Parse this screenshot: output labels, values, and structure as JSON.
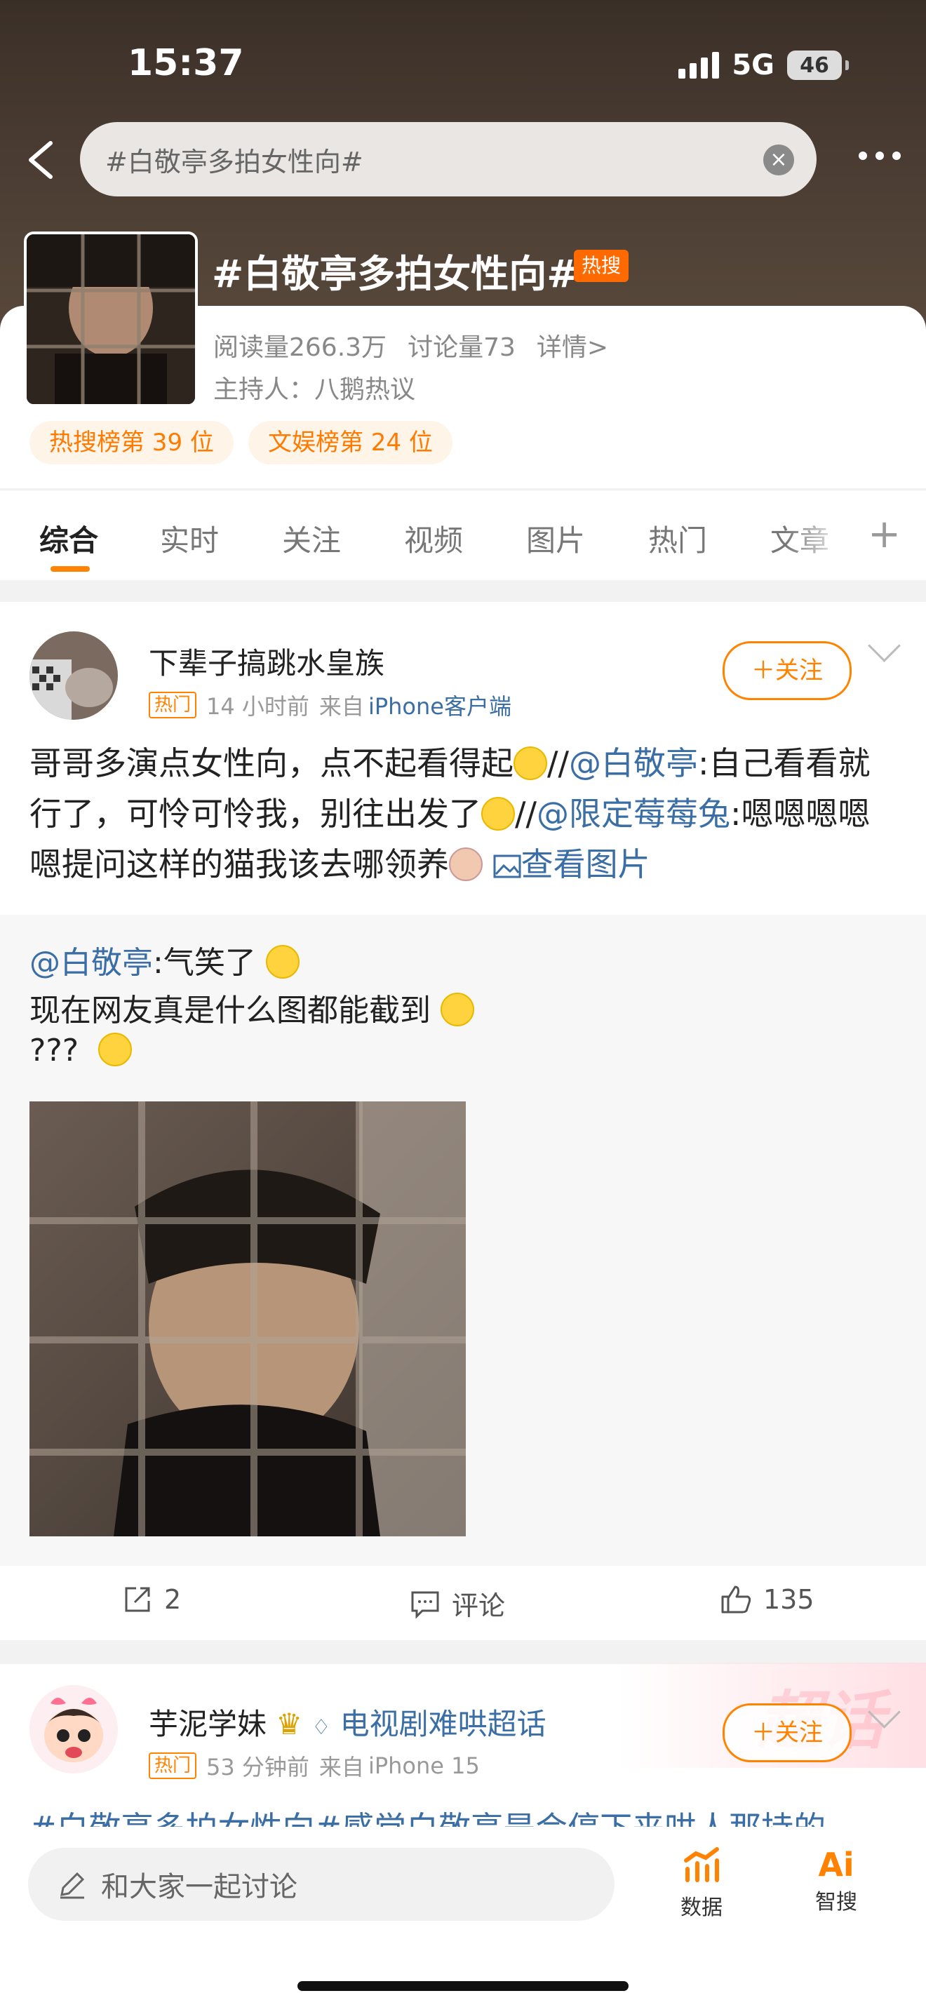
{
  "status_bar": {
    "time": "15:37",
    "network": "5G",
    "battery": "46"
  },
  "search": {
    "query": "#白敬亭多拍女性向#"
  },
  "topic": {
    "title": "#白敬亭多拍女性向#",
    "hot_badge": "热搜",
    "reads": "阅读量266.3万",
    "discussions": "讨论量73",
    "details": "详情>",
    "host": "主持人：八鹅热议",
    "ranks": [
      "热搜榜第 39 位",
      "文娱榜第 24 位"
    ]
  },
  "tabs": [
    "综合",
    "实时",
    "关注",
    "视频",
    "图片",
    "热门",
    "文章"
  ],
  "post1": {
    "user": "下辈子搞跳水皇族",
    "tag": "热门",
    "time": "14 小时前",
    "source_prefix": "来自",
    "source": "iPhone客户端",
    "follow": "＋关注",
    "text_a": "哥哥多演点女性向，点不起看得起",
    "sep1": "//",
    "mention1": "@白敬亭",
    "text_b": ":自己看看就行了，可怜可怜我，别往出发了",
    "sep2": "//",
    "mention2": "@限定莓莓兔",
    "text_c": ":嗯嗯嗯嗯嗯提问这样的猫我该去哪领养",
    "view_image": "查看图片",
    "repost": {
      "mention": "@白敬亭",
      "line1": ":气笑了",
      "line2": "现在网友真是什么图都能截到",
      "line3": "???"
    },
    "actions": {
      "share_count": "2",
      "comment": "评论",
      "like_count": "135"
    }
  },
  "post2": {
    "user": "芋泥学妹",
    "supertopic": "电视剧难哄超话",
    "tag": "热门",
    "time": "53 分钟前",
    "source_prefix": "来自",
    "source": "iPhone 15",
    "follow": "＋关注",
    "text_peek": "#白敬亭多拍女性向#感觉白敬亭是会停下来哄人那持的"
  },
  "bottom_bar": {
    "compose_placeholder": "和大家一起讨论",
    "data_label": "数据",
    "ai_label": "智搜"
  },
  "colors": {
    "accent": "#ff8200",
    "link": "#3a6ea5",
    "hot_badge": "#ff6a00"
  }
}
